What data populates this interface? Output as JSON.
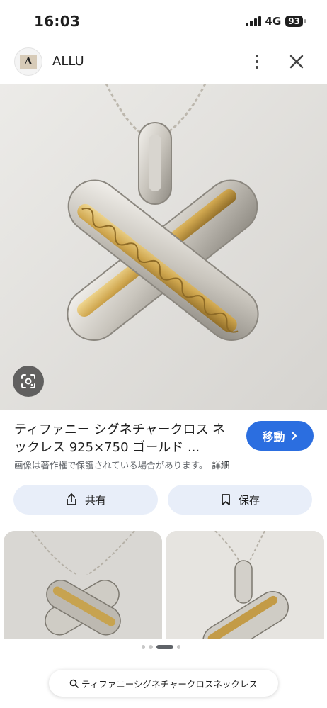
{
  "status_bar": {
    "time": "16:03",
    "network": "4G",
    "battery": "93"
  },
  "header": {
    "logo_letter": "A",
    "site_name": "ALLU",
    "more_icon": "more-vert-icon",
    "close_icon": "close-icon"
  },
  "image": {
    "lens_icon": "lens-icon"
  },
  "result": {
    "title": "ティファニー シグネチャークロス ネックレス 925×750 ゴールド ...",
    "visit_label": "移動",
    "notice": "画像は著作権で保護されている場合があります。",
    "details_label": "詳細"
  },
  "actions": {
    "share_label": "共有",
    "save_label": "保存"
  },
  "bottom": {
    "search_query": "ティファニーシグネチャークロスネックレス"
  },
  "colors": {
    "accent": "#2b6ee0",
    "chip_bg": "#e8eef9"
  }
}
